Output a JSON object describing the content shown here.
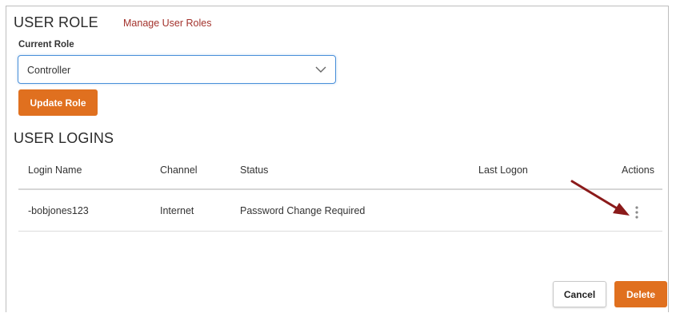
{
  "user_role": {
    "title": "USER ROLE",
    "manage_link": "Manage User Roles",
    "current_role_label": "Current Role",
    "current_role_value": "Controller",
    "update_button": "Update Role"
  },
  "user_logins": {
    "title": "USER LOGINS",
    "columns": [
      "Login Name",
      "Channel",
      "Status",
      "Last Logon",
      "Actions"
    ],
    "rows": [
      {
        "login_name": "-bobjones123",
        "channel": "Internet",
        "status": "Password Change Required",
        "last_logon": ""
      }
    ]
  },
  "footer": {
    "cancel_button": "Cancel",
    "delete_button": "Delete"
  },
  "colors": {
    "accent_orange": "#e0701f",
    "link_red": "#a3322c",
    "focus_blue": "#4a90d9",
    "annotation_arrow": "#8b1a1a"
  },
  "icons": {
    "select_toggle": "chevron-down-icon",
    "row_actions": "kebab-menu-icon",
    "annotation": "pointer-arrow-icon"
  }
}
